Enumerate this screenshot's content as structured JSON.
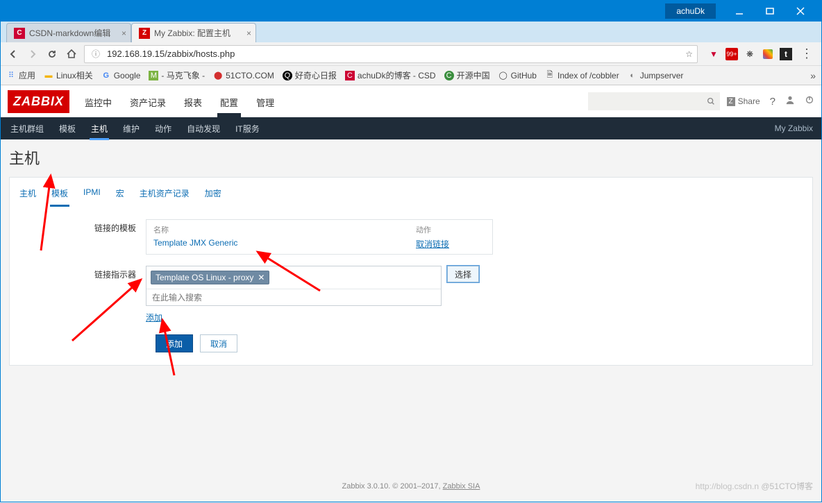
{
  "window": {
    "user": "achuDk"
  },
  "browser": {
    "tabs": [
      {
        "title": "CSDN-markdown编辑",
        "active": false
      },
      {
        "title": "My Zabbix: 配置主机",
        "active": true
      }
    ],
    "url": "192.168.19.15/zabbix/hosts.php",
    "bookmarks": [
      "应用",
      "Linux相关",
      "Google",
      "- 马克飞象 -",
      "51CTO.COM",
      "好奇心日报",
      "achuDk的博客 - CSD",
      "开源中国",
      "GitHub",
      "Index of /cobbler",
      "Jumpserver"
    ]
  },
  "zabbix": {
    "logo": "ZABBIX",
    "menu": [
      "监控中",
      "资产记录",
      "报表",
      "配置",
      "管理"
    ],
    "menu_active": "配置",
    "share": "Share",
    "subnav": [
      "主机群组",
      "模板",
      "主机",
      "维护",
      "动作",
      "自动发现",
      "IT服务"
    ],
    "subnav_active": "主机",
    "subnav_right": "My Zabbix"
  },
  "page": {
    "title": "主机",
    "tabs": [
      "主机",
      "模板",
      "IPMI",
      "宏",
      "主机资产记录",
      "加密"
    ],
    "tab_active": "模板",
    "linked_templates": {
      "label": "链接的模板",
      "headers": {
        "name": "名称",
        "action": "动作"
      },
      "row": {
        "name": "Template JMX Generic",
        "action": "取消链接"
      }
    },
    "link_indicator": {
      "label": "链接指示器",
      "tag": "Template OS Linux - proxy",
      "placeholder": "在此输入搜索",
      "select": "选择",
      "add_link": "添加"
    },
    "buttons": {
      "add": "添加",
      "cancel": "取消"
    }
  },
  "footer": {
    "text": "Zabbix 3.0.10. © 2001–2017, ",
    "link": "Zabbix SIA"
  },
  "watermark": {
    "url": "http://blog.csdn.n",
    "tag": "@51CTO博客"
  }
}
